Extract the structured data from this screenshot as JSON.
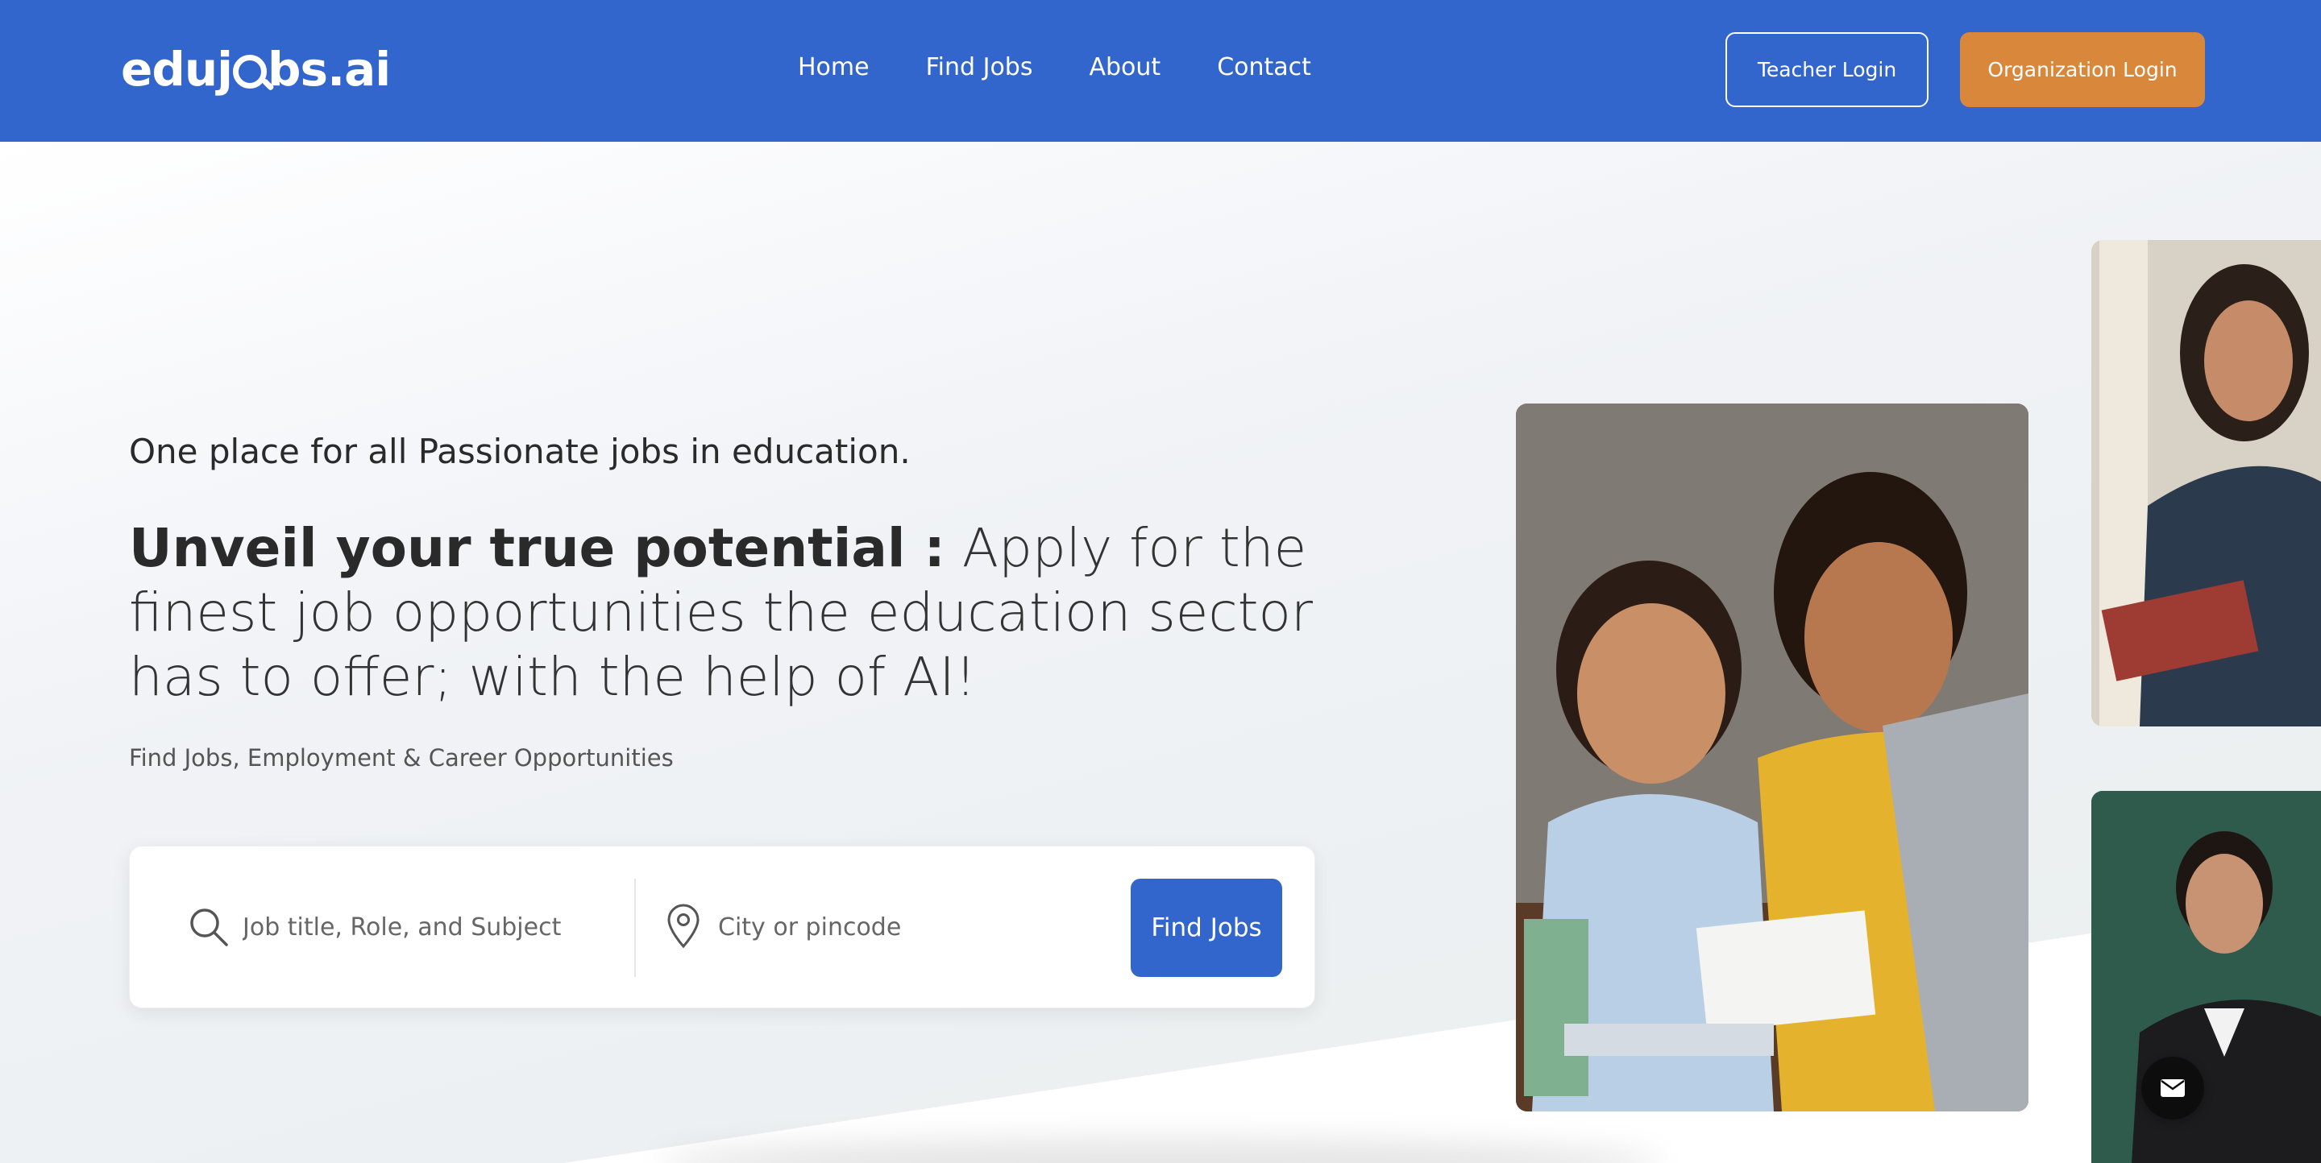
{
  "nav": {
    "logo_text_before": "eduj",
    "logo_text_after": "bs.ai",
    "links": [
      "Home",
      "Find Jobs",
      "About",
      "Contact"
    ],
    "teacher_login": "Teacher Login",
    "organization_login": "Organization Login"
  },
  "hero": {
    "tagline": "One place for all Passionate jobs in education.",
    "headline_bold": "Unveil your true potential :",
    "headline_rest": " Apply for the finest job opportunities the education sector has to offer; with the help of AI!",
    "subtext": "Find Jobs, Employment & Career Opportunities"
  },
  "search": {
    "job_placeholder": "Job title, Role, and Subject",
    "city_placeholder": "City or pincode",
    "button_label": "Find Jobs"
  },
  "colors": {
    "brand_blue": "#3366cc",
    "accent_orange": "#d9873a"
  },
  "icons": [
    "search-icon",
    "location-pin-icon",
    "mail-icon",
    "logo-magnifier-icon"
  ]
}
